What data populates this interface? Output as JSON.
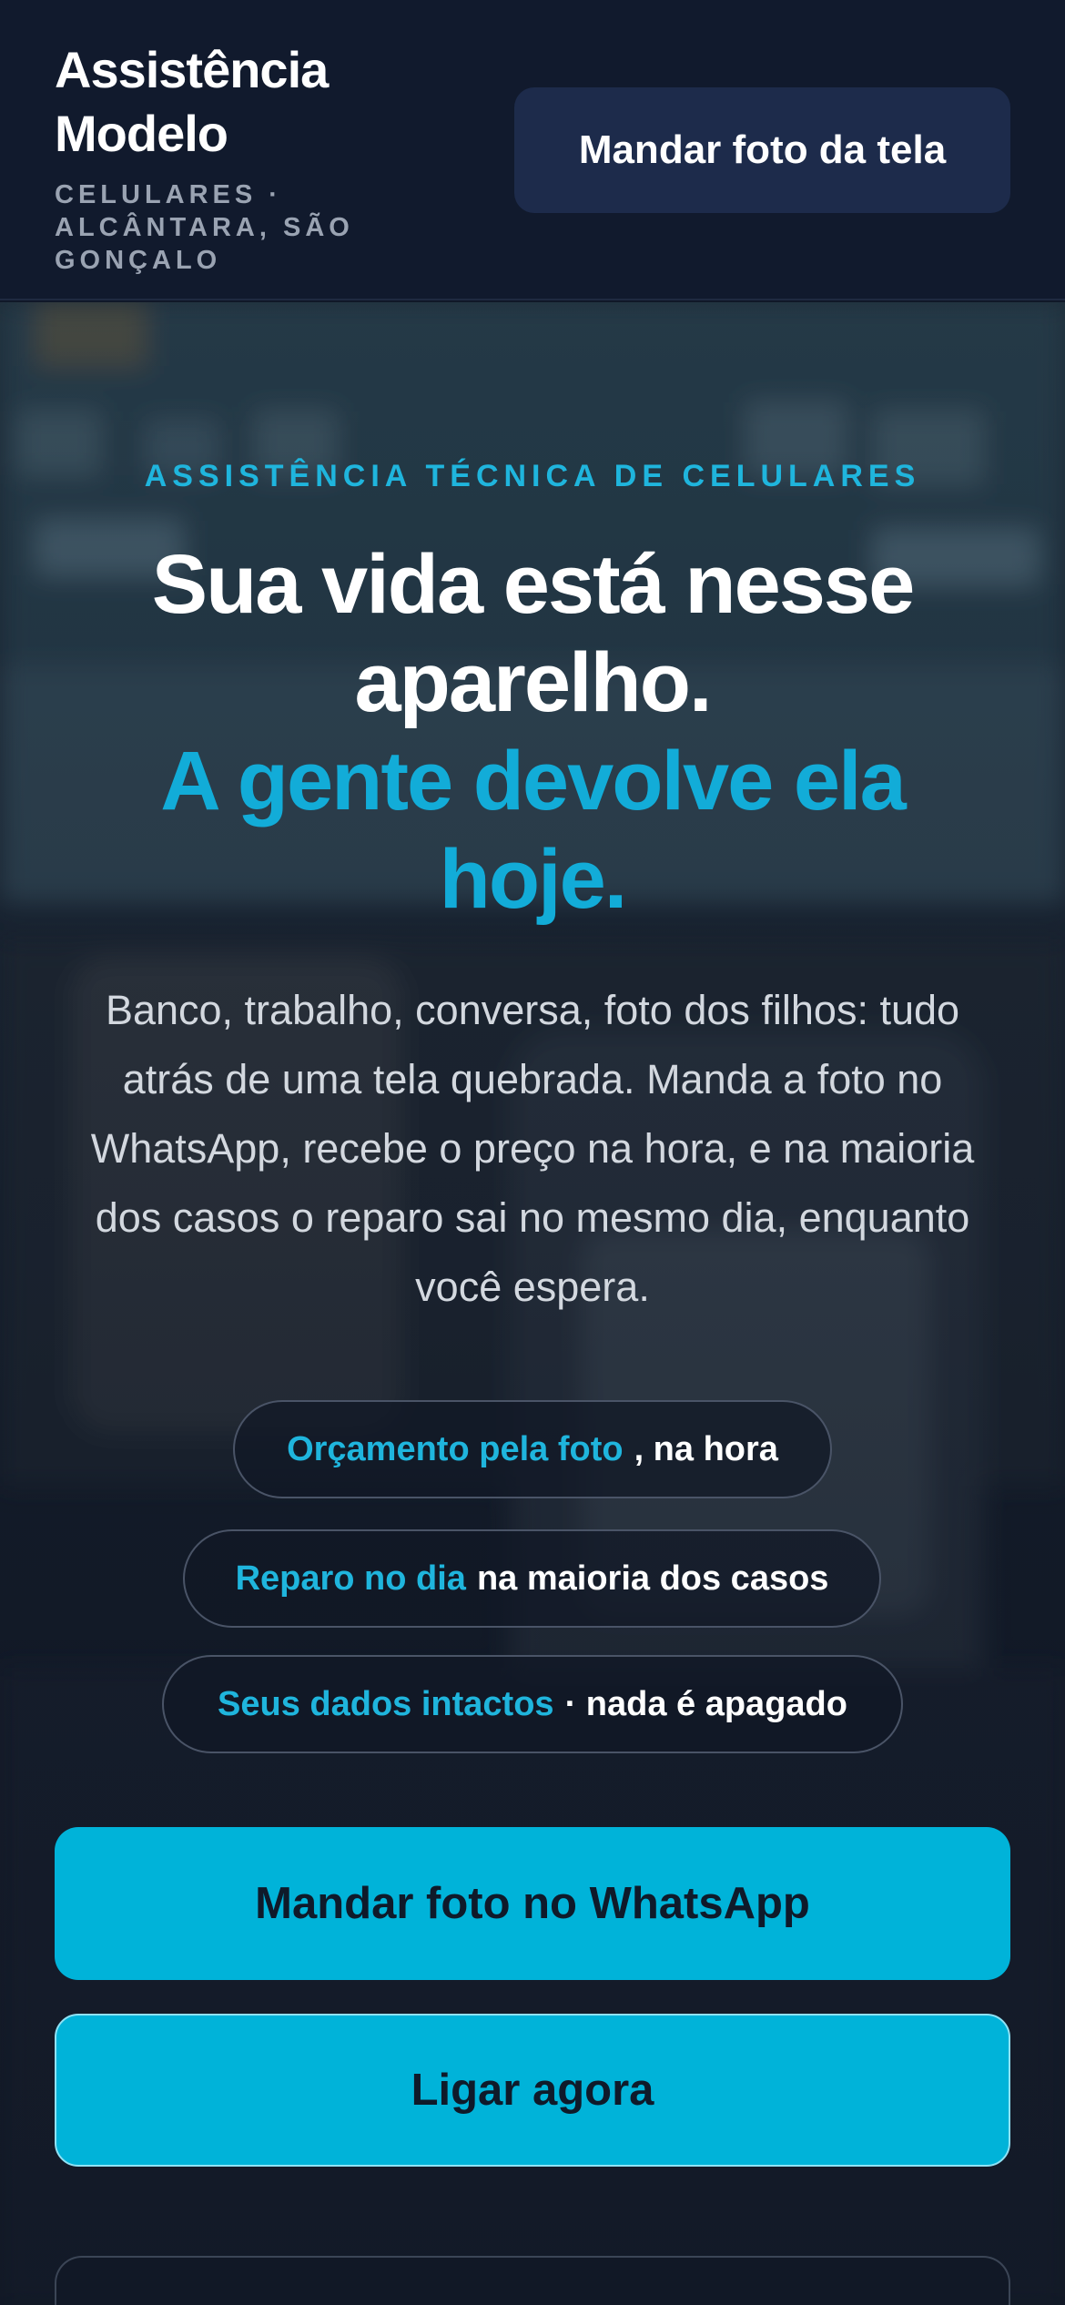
{
  "header": {
    "brand_name": "Assistência Modelo",
    "brand_subtitle": "CELULARES · ALCÂNTARA, SÃO GONÇALO",
    "cta_label": "Mandar foto da tela"
  },
  "hero": {
    "eyebrow": "ASSISTÊNCIA TÉCNICA DE CELULARES",
    "headline_white": "Sua vida está nesse aparelho.",
    "headline_accent": "A gente devolve ela hoje.",
    "lead": "Banco, trabalho, conversa, foto dos filhos: tudo atrás de uma tela quebrada. Manda a foto no WhatsApp, recebe o preço na hora, e na maioria dos casos o reparo sai no mesmo dia, enquanto você espera.",
    "pills": [
      {
        "highlight": "Orçamento pela foto",
        "rest": ", na hora"
      },
      {
        "highlight": "Reparo no dia",
        "rest": "na maioria dos casos"
      },
      {
        "highlight": "Seus dados intactos",
        "rest": "· nada é apagado"
      }
    ],
    "primary_cta": "Mandar foto no WhatsApp",
    "secondary_cta": "Ligar agora"
  },
  "colors": {
    "accent": "#12acd8",
    "button": "#00b3d9",
    "header_bg": "#111a2d",
    "header_button_bg": "#1d2b4b"
  }
}
